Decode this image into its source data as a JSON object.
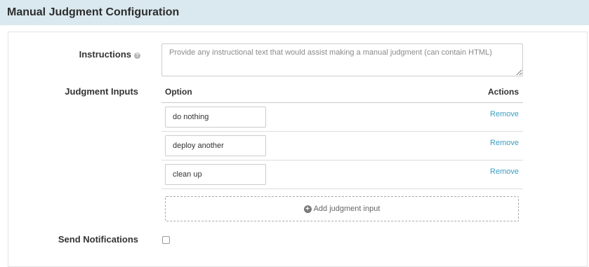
{
  "header": {
    "title": "Manual Judgment Configuration"
  },
  "form": {
    "instructions": {
      "label": "Instructions",
      "help_icon": "question-circle-icon",
      "placeholder": "Provide any instructional text that would assist making a manual judgment (can contain HTML)",
      "value": ""
    },
    "judgment_inputs": {
      "label": "Judgment Inputs",
      "col_option": "Option",
      "col_actions": "Actions",
      "rows": [
        {
          "value": "do nothing",
          "remove_label": "Remove"
        },
        {
          "value": "deploy another",
          "remove_label": "Remove"
        },
        {
          "value": "clean up",
          "remove_label": "Remove"
        }
      ],
      "add_label": "Add judgment input",
      "add_icon": "plus-circle-icon"
    },
    "notifications": {
      "label": "Send Notifications",
      "checked": false
    }
  },
  "colors": {
    "header_bg": "#dae9ef",
    "link": "#3a9ec0"
  }
}
